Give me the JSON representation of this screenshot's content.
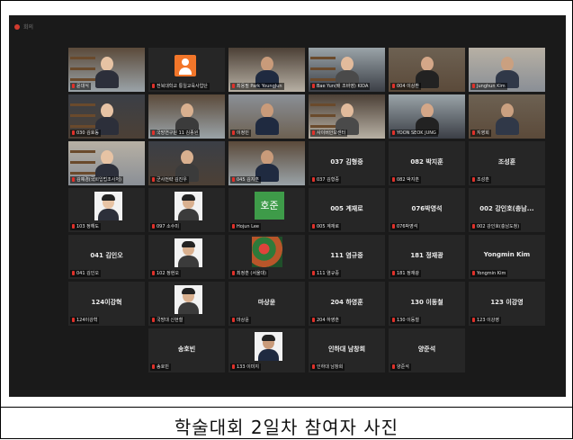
{
  "window": {
    "title": "회의"
  },
  "figure_caption": "학술대회 2일차 참여자 사진",
  "colors": {
    "background": "#1a1a1a",
    "tile": "#262626",
    "speaking_border": "#e8e24a",
    "mic_muted": "#e0312a"
  },
  "tiles": [
    {
      "caption": "윤대식",
      "kind": "video"
    },
    {
      "caption": "전북대학교 통일교육사업단",
      "kind": "avatar-orange"
    },
    {
      "caption": "최용필 Park YoungJun",
      "kind": "video"
    },
    {
      "caption": "Bae Yun(배 조바영) KIDA",
      "kind": "video"
    },
    {
      "caption": "004 이상환",
      "kind": "video"
    },
    {
      "caption": "Junghun Kim",
      "kind": "video"
    },
    {
      "caption": "030 김호동",
      "kind": "video"
    },
    {
      "caption": "국방연구원 11 김종원",
      "kind": "video"
    },
    {
      "caption": "이정민",
      "kind": "video"
    },
    {
      "caption": "사이버안보센터",
      "kind": "video"
    },
    {
      "caption": "YOON SEOK JUNG",
      "kind": "video"
    },
    {
      "caption": "지영희",
      "kind": "video"
    },
    {
      "caption": "김예경(국회입법조사처)",
      "kind": "video",
      "speaking": true
    },
    {
      "caption": "군사전략 김진우",
      "kind": "video"
    },
    {
      "caption": "045 김지훈",
      "kind": "video"
    },
    {
      "name": "037 김형중",
      "caption": "037 김형중",
      "kind": "name"
    },
    {
      "name": "082 박지훈",
      "caption": "082 박지훈",
      "kind": "name"
    },
    {
      "name": "조성훈",
      "caption": "조성훈",
      "kind": "name"
    },
    {
      "caption": "103 정해도",
      "kind": "portrait"
    },
    {
      "caption": "097 소수미",
      "kind": "portrait"
    },
    {
      "caption": "Hojun Lee",
      "kind": "logo",
      "logo_text": "호준"
    },
    {
      "name": "005 계재로",
      "caption": "005 계재로",
      "kind": "name"
    },
    {
      "name": "076박영석",
      "caption": "076박영석",
      "kind": "name"
    },
    {
      "name": "002 강인호(충남...",
      "caption": "002 강인호(충남도청)",
      "kind": "name"
    },
    {
      "name": "041 김인오",
      "caption": "041 김인오",
      "kind": "name"
    },
    {
      "caption": "102 정현오",
      "kind": "portrait"
    },
    {
      "caption": "최정훈 (서울대)",
      "kind": "art"
    },
    {
      "name": "111 염규중",
      "caption": "111 염규중",
      "kind": "name"
    },
    {
      "name": "181 정재광",
      "caption": "181 정재광",
      "kind": "name"
    },
    {
      "name": "Yongmin Kim",
      "caption": "Yongmin Kim",
      "kind": "name"
    },
    {
      "name": "124이강혁",
      "caption": "124이강혁",
      "kind": "name"
    },
    {
      "caption": "국방대 신현철",
      "kind": "portrait"
    },
    {
      "name": "마상윤",
      "caption": "마상윤",
      "kind": "name"
    },
    {
      "name": "204 하영훈",
      "caption": "204 하영훈",
      "kind": "name"
    },
    {
      "name": "130 이동철",
      "caption": "130 이동철",
      "kind": "name"
    },
    {
      "name": "123 이강영",
      "caption": "123 이강영",
      "kind": "name"
    },
    {
      "kind": "empty"
    },
    {
      "name": "송호빈",
      "caption": "송호빈",
      "kind": "name"
    },
    {
      "caption": "133 이미지",
      "kind": "portrait"
    },
    {
      "name": "인하대 남창희",
      "caption": "인하대 남창희",
      "kind": "name"
    },
    {
      "name": "양준석",
      "caption": "양준석",
      "kind": "name"
    },
    {
      "kind": "empty"
    }
  ]
}
